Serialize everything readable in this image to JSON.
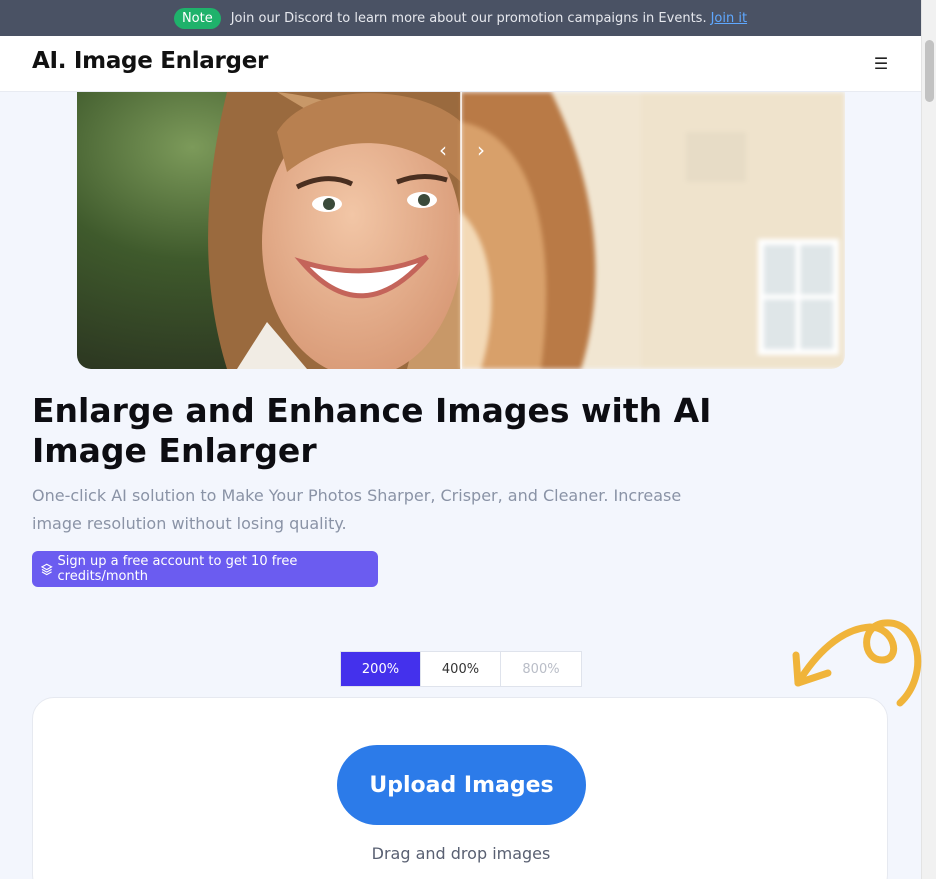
{
  "announcement": {
    "badge": "Note",
    "text": "Join our Discord to learn more about our promotion campaigns in Events.",
    "link": "Join it"
  },
  "header": {
    "logo": "AI. Image Enlarger",
    "menu_icon": "☰"
  },
  "hero": {
    "prev_icon": "‹",
    "next_icon": "›"
  },
  "main": {
    "headline": "Enlarge and Enhance Images with AI Image Enlarger",
    "subtitle": "One-click AI solution to Make Your Photos Sharper, Crisper, and Cleaner. Increase image resolution without losing quality.",
    "signup_label": "Sign up a free account to get 10 free credits/month"
  },
  "scale": {
    "options": [
      "200%",
      "400%",
      "800%"
    ],
    "selected": "200%"
  },
  "upload": {
    "button_label": "Upload Images",
    "drag_text": "Drag and drop images"
  },
  "colors": {
    "accent": "#4431ec",
    "upload_blue": "#2c7be9",
    "signup_purple": "#6b5cf0",
    "note_green": "#1fb26b",
    "doodle_orange": "#f0b43a"
  }
}
